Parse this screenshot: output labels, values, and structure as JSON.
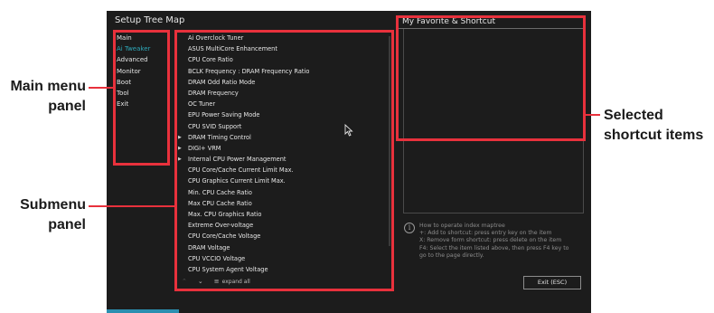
{
  "window": {
    "title": "Setup Tree Map"
  },
  "main_menu": {
    "items": [
      {
        "label": "Main",
        "active": false
      },
      {
        "label": "Ai Tweaker",
        "active": true
      },
      {
        "label": "Advanced",
        "active": false
      },
      {
        "label": "Monitor",
        "active": false
      },
      {
        "label": "Boot",
        "active": false
      },
      {
        "label": "Tool",
        "active": false
      },
      {
        "label": "Exit",
        "active": false
      }
    ]
  },
  "submenu": {
    "items": [
      {
        "label": "Ai Overclock Tuner",
        "expandable": false
      },
      {
        "label": "ASUS MultiCore Enhancement",
        "expandable": false
      },
      {
        "label": "CPU Core Ratio",
        "expandable": false
      },
      {
        "label": "BCLK Frequency : DRAM Frequency Ratio",
        "expandable": false
      },
      {
        "label": "DRAM Odd Ratio Mode",
        "expandable": false
      },
      {
        "label": "DRAM Frequency",
        "expandable": false
      },
      {
        "label": "OC Tuner",
        "expandable": false
      },
      {
        "label": "EPU Power Saving Mode",
        "expandable": false
      },
      {
        "label": "CPU SVID Support",
        "expandable": false
      },
      {
        "label": "DRAM Timing Control",
        "expandable": true
      },
      {
        "label": "DIGI+ VRM",
        "expandable": true
      },
      {
        "label": "Internal CPU Power Management",
        "expandable": true
      },
      {
        "label": "CPU Core/Cache Current Limit Max.",
        "expandable": false
      },
      {
        "label": "CPU Graphics Current Limit Max.",
        "expandable": false
      },
      {
        "label": "Min. CPU Cache Ratio",
        "expandable": false
      },
      {
        "label": "Max CPU Cache Ratio",
        "expandable": false
      },
      {
        "label": "Max. CPU Graphics Ratio",
        "expandable": false
      },
      {
        "label": "Extreme Over-voltage",
        "expandable": false
      },
      {
        "label": "CPU Core/Cache Voltage",
        "expandable": false
      },
      {
        "label": "DRAM Voltage",
        "expandable": false
      },
      {
        "label": "CPU VCCIO Voltage",
        "expandable": false
      },
      {
        "label": "CPU System Agent Voltage",
        "expandable": false
      }
    ],
    "footer": {
      "expand_all_label": "expand all"
    }
  },
  "favorite": {
    "title": "My Favorite & Shortcut",
    "info_lines": [
      "How to operate index maptree",
      "+: Add to shortcut: press entry key on the item",
      "X: Remove form shortcut: press delete on the item",
      "F4: Select the item listed above, then press F4 key to",
      "go to the page directly."
    ],
    "exit_label": "Exit (ESC)"
  },
  "callouts": {
    "main_menu": [
      "Main menu",
      "panel"
    ],
    "submenu": [
      "Submenu",
      "panel"
    ],
    "selected": [
      "Selected",
      "shortcut items"
    ]
  },
  "colors": {
    "highlight_border": "#e8313c",
    "active_menu_item": "#2ea7b8",
    "background": "#1c1c1c"
  }
}
